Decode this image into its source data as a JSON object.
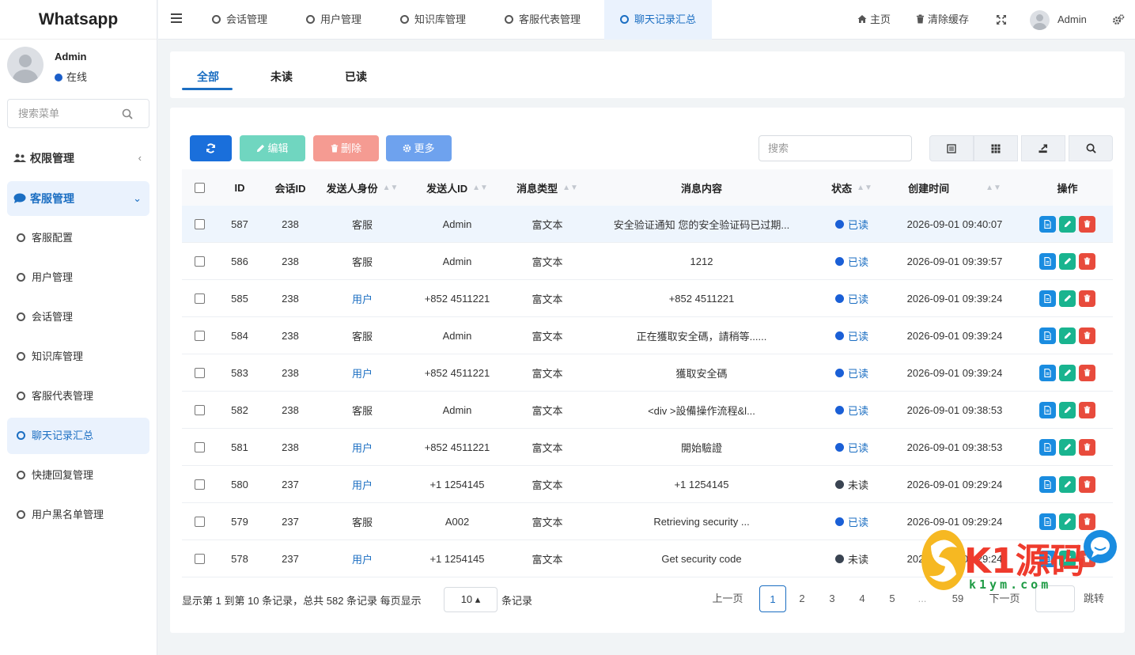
{
  "sidebar": {
    "brand": "Whatsapp",
    "user": {
      "name": "Admin",
      "status": "在线"
    },
    "search_placeholder": "搜索菜单",
    "groups": [
      {
        "label": "权限管理",
        "arrow": "‹"
      },
      {
        "label": "客服管理",
        "arrow": "⌄"
      }
    ],
    "items": [
      "客服配置",
      "用户管理",
      "会话管理",
      "知识库管理",
      "客服代表管理",
      "聊天记录汇总",
      "快捷回复管理",
      "用户黑名单管理"
    ]
  },
  "topbar": {
    "tabs": [
      "会话管理",
      "用户管理",
      "知识库管理",
      "客服代表管理",
      "聊天记录汇总"
    ],
    "home": "主页",
    "clear_cache": "清除缓存",
    "user": "Admin"
  },
  "filter_tabs": [
    "全部",
    "未读",
    "已读"
  ],
  "toolbar": {
    "edit": "编辑",
    "delete": "删除",
    "more": "更多",
    "search_placeholder": "搜索"
  },
  "table": {
    "headers": [
      "ID",
      "会话ID",
      "发送人身份",
      "发送人ID",
      "消息类型",
      "消息内容",
      "状态",
      "创建时间",
      "操作"
    ],
    "rows": [
      {
        "id": "587",
        "session": "238",
        "role": "客服",
        "sender": "Admin",
        "type": "富文本",
        "content": "安全验证通知 您的安全验证码已过期...",
        "status": "已读",
        "time": "2026-09-01 09:40:07"
      },
      {
        "id": "586",
        "session": "238",
        "role": "客服",
        "sender": "Admin",
        "type": "富文本",
        "content": "1212",
        "status": "已读",
        "time": "2026-09-01 09:39:57"
      },
      {
        "id": "585",
        "session": "238",
        "role": "用户",
        "sender": "+852 4511221",
        "type": "富文本",
        "content": "+852 4511221",
        "status": "已读",
        "time": "2026-09-01 09:39:24"
      },
      {
        "id": "584",
        "session": "238",
        "role": "客服",
        "sender": "Admin",
        "type": "富文本",
        "content": "正在獲取安全碼，請稍等......",
        "status": "已读",
        "time": "2026-09-01 09:39:24"
      },
      {
        "id": "583",
        "session": "238",
        "role": "用户",
        "sender": "+852 4511221",
        "type": "富文本",
        "content": "獲取安全碼",
        "status": "已读",
        "time": "2026-09-01 09:39:24"
      },
      {
        "id": "582",
        "session": "238",
        "role": "客服",
        "sender": "Admin",
        "type": "富文本",
        "content": "<div >設備操作流程&l...",
        "status": "已读",
        "time": "2026-09-01 09:38:53"
      },
      {
        "id": "581",
        "session": "238",
        "role": "用户",
        "sender": "+852 4511221",
        "type": "富文本",
        "content": "開始驗證",
        "status": "已读",
        "time": "2026-09-01 09:38:53"
      },
      {
        "id": "580",
        "session": "237",
        "role": "用户",
        "sender": "+1 1254145",
        "type": "富文本",
        "content": "+1 1254145",
        "status": "未读",
        "time": "2026-09-01 09:29:24"
      },
      {
        "id": "579",
        "session": "237",
        "role": "客服",
        "sender": "A002",
        "type": "富文本",
        "content": "Retrieving security ...",
        "status": "已读",
        "time": "2026-09-01 09:29:24"
      },
      {
        "id": "578",
        "session": "237",
        "role": "用户",
        "sender": "+1 1254145",
        "type": "富文本",
        "content": "Get security code",
        "status": "未读",
        "time": "2026-09-01 09:29:24"
      }
    ]
  },
  "pagination": {
    "info": "显示第 1 到第 10 条记录，总共 582 条记录 每页显示",
    "page_size": "10 ▴",
    "suffix": "条记录",
    "prev": "上一页",
    "pages": [
      "1",
      "2",
      "3",
      "4",
      "5",
      "...",
      "59"
    ],
    "next": "下一页",
    "jump": "跳转"
  },
  "watermark": {
    "brand": "K1源码",
    "domain": "k1ym.com"
  },
  "colors": {
    "primary": "#1b6ec2",
    "read": "#1a5fd6",
    "unread": "#3a4452"
  }
}
